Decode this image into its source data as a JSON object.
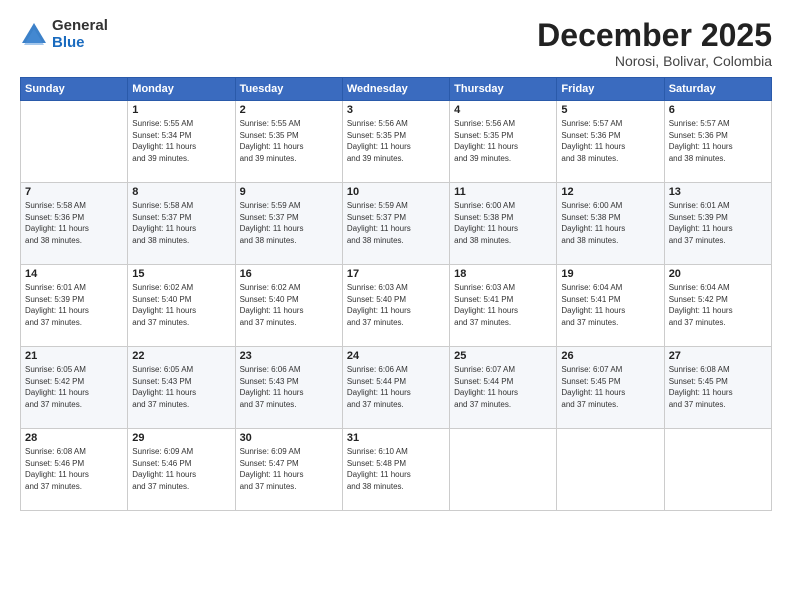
{
  "logo": {
    "general": "General",
    "blue": "Blue"
  },
  "title": "December 2025",
  "location": "Norosi, Bolivar, Colombia",
  "days_header": [
    "Sunday",
    "Monday",
    "Tuesday",
    "Wednesday",
    "Thursday",
    "Friday",
    "Saturday"
  ],
  "weeks": [
    [
      {
        "day": "",
        "info": ""
      },
      {
        "day": "1",
        "info": "Sunrise: 5:55 AM\nSunset: 5:34 PM\nDaylight: 11 hours\nand 39 minutes."
      },
      {
        "day": "2",
        "info": "Sunrise: 5:55 AM\nSunset: 5:35 PM\nDaylight: 11 hours\nand 39 minutes."
      },
      {
        "day": "3",
        "info": "Sunrise: 5:56 AM\nSunset: 5:35 PM\nDaylight: 11 hours\nand 39 minutes."
      },
      {
        "day": "4",
        "info": "Sunrise: 5:56 AM\nSunset: 5:35 PM\nDaylight: 11 hours\nand 39 minutes."
      },
      {
        "day": "5",
        "info": "Sunrise: 5:57 AM\nSunset: 5:36 PM\nDaylight: 11 hours\nand 38 minutes."
      },
      {
        "day": "6",
        "info": "Sunrise: 5:57 AM\nSunset: 5:36 PM\nDaylight: 11 hours\nand 38 minutes."
      }
    ],
    [
      {
        "day": "7",
        "info": "Sunrise: 5:58 AM\nSunset: 5:36 PM\nDaylight: 11 hours\nand 38 minutes."
      },
      {
        "day": "8",
        "info": "Sunrise: 5:58 AM\nSunset: 5:37 PM\nDaylight: 11 hours\nand 38 minutes."
      },
      {
        "day": "9",
        "info": "Sunrise: 5:59 AM\nSunset: 5:37 PM\nDaylight: 11 hours\nand 38 minutes."
      },
      {
        "day": "10",
        "info": "Sunrise: 5:59 AM\nSunset: 5:37 PM\nDaylight: 11 hours\nand 38 minutes."
      },
      {
        "day": "11",
        "info": "Sunrise: 6:00 AM\nSunset: 5:38 PM\nDaylight: 11 hours\nand 38 minutes."
      },
      {
        "day": "12",
        "info": "Sunrise: 6:00 AM\nSunset: 5:38 PM\nDaylight: 11 hours\nand 38 minutes."
      },
      {
        "day": "13",
        "info": "Sunrise: 6:01 AM\nSunset: 5:39 PM\nDaylight: 11 hours\nand 37 minutes."
      }
    ],
    [
      {
        "day": "14",
        "info": "Sunrise: 6:01 AM\nSunset: 5:39 PM\nDaylight: 11 hours\nand 37 minutes."
      },
      {
        "day": "15",
        "info": "Sunrise: 6:02 AM\nSunset: 5:40 PM\nDaylight: 11 hours\nand 37 minutes."
      },
      {
        "day": "16",
        "info": "Sunrise: 6:02 AM\nSunset: 5:40 PM\nDaylight: 11 hours\nand 37 minutes."
      },
      {
        "day": "17",
        "info": "Sunrise: 6:03 AM\nSunset: 5:40 PM\nDaylight: 11 hours\nand 37 minutes."
      },
      {
        "day": "18",
        "info": "Sunrise: 6:03 AM\nSunset: 5:41 PM\nDaylight: 11 hours\nand 37 minutes."
      },
      {
        "day": "19",
        "info": "Sunrise: 6:04 AM\nSunset: 5:41 PM\nDaylight: 11 hours\nand 37 minutes."
      },
      {
        "day": "20",
        "info": "Sunrise: 6:04 AM\nSunset: 5:42 PM\nDaylight: 11 hours\nand 37 minutes."
      }
    ],
    [
      {
        "day": "21",
        "info": "Sunrise: 6:05 AM\nSunset: 5:42 PM\nDaylight: 11 hours\nand 37 minutes."
      },
      {
        "day": "22",
        "info": "Sunrise: 6:05 AM\nSunset: 5:43 PM\nDaylight: 11 hours\nand 37 minutes."
      },
      {
        "day": "23",
        "info": "Sunrise: 6:06 AM\nSunset: 5:43 PM\nDaylight: 11 hours\nand 37 minutes."
      },
      {
        "day": "24",
        "info": "Sunrise: 6:06 AM\nSunset: 5:44 PM\nDaylight: 11 hours\nand 37 minutes."
      },
      {
        "day": "25",
        "info": "Sunrise: 6:07 AM\nSunset: 5:44 PM\nDaylight: 11 hours\nand 37 minutes."
      },
      {
        "day": "26",
        "info": "Sunrise: 6:07 AM\nSunset: 5:45 PM\nDaylight: 11 hours\nand 37 minutes."
      },
      {
        "day": "27",
        "info": "Sunrise: 6:08 AM\nSunset: 5:45 PM\nDaylight: 11 hours\nand 37 minutes."
      }
    ],
    [
      {
        "day": "28",
        "info": "Sunrise: 6:08 AM\nSunset: 5:46 PM\nDaylight: 11 hours\nand 37 minutes."
      },
      {
        "day": "29",
        "info": "Sunrise: 6:09 AM\nSunset: 5:46 PM\nDaylight: 11 hours\nand 37 minutes."
      },
      {
        "day": "30",
        "info": "Sunrise: 6:09 AM\nSunset: 5:47 PM\nDaylight: 11 hours\nand 37 minutes."
      },
      {
        "day": "31",
        "info": "Sunrise: 6:10 AM\nSunset: 5:48 PM\nDaylight: 11 hours\nand 38 minutes."
      },
      {
        "day": "",
        "info": ""
      },
      {
        "day": "",
        "info": ""
      },
      {
        "day": "",
        "info": ""
      }
    ]
  ]
}
